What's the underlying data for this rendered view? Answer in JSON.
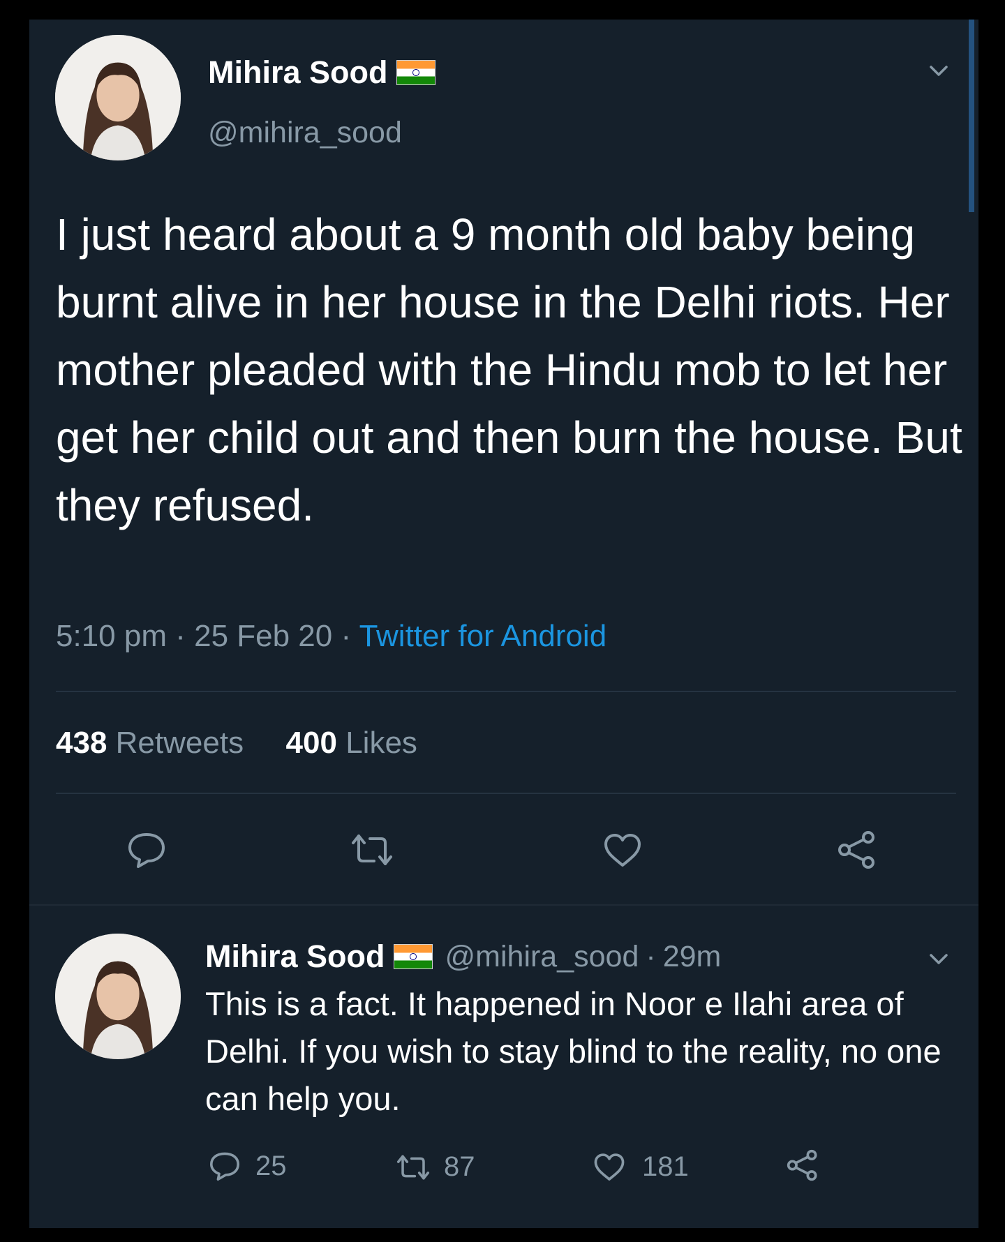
{
  "tweet": {
    "author_name": "Mihira Sood",
    "handle": "@mihira_sood",
    "text": "I just heard about a 9 month old baby being burnt alive in her house in the Delhi riots. Her mother pleaded with the Hindu mob to let her get her child out and then burn the house. But they refused.",
    "time": "5:10 pm",
    "date": "25 Feb 20",
    "source": "Twitter for Android",
    "retweets_count": "438",
    "retweets_label": "Retweets",
    "likes_count": "400",
    "likes_label": "Likes"
  },
  "reply": {
    "author_name": "Mihira Sood",
    "handle": "@mihira_sood",
    "age": "29m",
    "text": "This is a fact. It happened in Noor e Ilahi area of Delhi. If you wish to stay blind to the reality, no one can help you.",
    "reply_count": "25",
    "retweet_count": "87",
    "like_count": "181"
  },
  "colors": {
    "background": "#15202b",
    "muted_text": "#8899a6",
    "link": "#1b95e0",
    "divider": "#253341"
  },
  "icons": {
    "reply": "speech-bubble-icon",
    "retweet": "retweet-arrows-icon",
    "like": "heart-icon",
    "share": "share-nodes-icon",
    "menu": "chevron-down-icon",
    "flag": "india-flag-icon"
  }
}
